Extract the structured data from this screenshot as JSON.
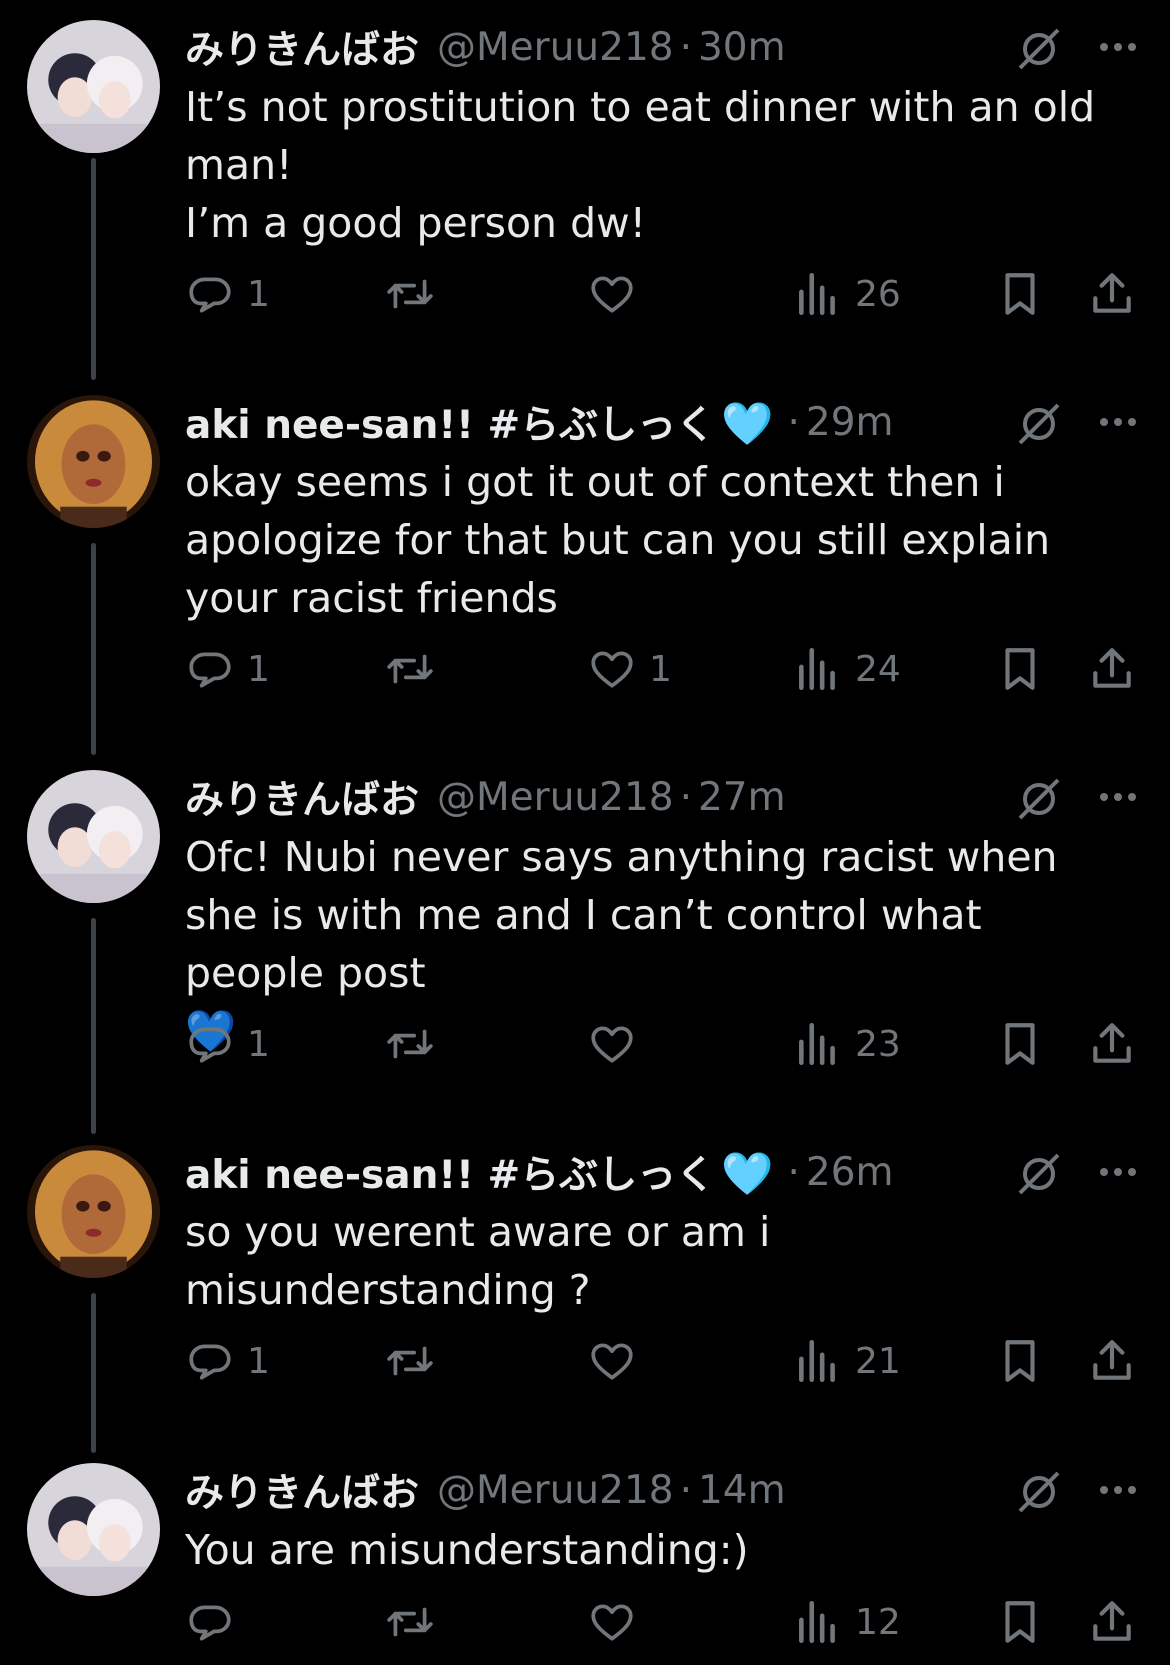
{
  "tweets": [
    {
      "author": "みりきんばお",
      "handle": "@Meruu218",
      "time": "30m",
      "lines": [
        "It’s not prostitution to eat dinner with an old",
        "man!",
        "I’m a good person dw!"
      ],
      "replies": "1",
      "retweets": "",
      "likes": "",
      "views": "26",
      "avatar": "meruu"
    },
    {
      "author": "aki nee-san!! #らぶしっく",
      "author_emoji": "🩵",
      "handle": "",
      "time": "29m",
      "lines": [
        "okay seems i got it out of context then i",
        "apologize for that but can you still explain",
        "your racist friends"
      ],
      "replies": "1",
      "retweets": "",
      "likes": "1",
      "views": "24",
      "avatar": "aki"
    },
    {
      "author": "みりきんばお",
      "handle": "@Meruu218",
      "time": "27m",
      "lines": [
        "Ofc! Nubi never says anything racist when",
        "she is with me and I can’t control what",
        "people post"
      ],
      "trailing_emoji": "💙",
      "replies": "1",
      "retweets": "",
      "likes": "",
      "views": "23",
      "avatar": "meruu"
    },
    {
      "author": "aki nee-san!! #らぶしっく",
      "author_emoji": "🩵",
      "handle": "",
      "time": "26m",
      "lines": [
        "so you werent aware or am i",
        "misunderstanding ?"
      ],
      "replies": "1",
      "retweets": "",
      "likes": "",
      "views": "21",
      "avatar": "aki"
    },
    {
      "author": "みりきんばお",
      "handle": "@Meruu218",
      "time": "14m",
      "lines": [
        "You are misunderstanding:)"
      ],
      "replies": "",
      "retweets": "",
      "likes": "",
      "views": "12",
      "avatar": "meruu"
    }
  ],
  "separator": "·",
  "icons": {
    "reply": "reply-icon",
    "retweet": "retweet-icon",
    "like": "like-icon",
    "views": "views-icon",
    "bookmark": "bookmark-icon",
    "share": "share-icon",
    "grok": "grok-icon",
    "more": "more-icon"
  },
  "colors": {
    "background": "#000000",
    "text": "#e7e9ea",
    "secondary": "#71767b",
    "thread_line": "#3c4248"
  }
}
